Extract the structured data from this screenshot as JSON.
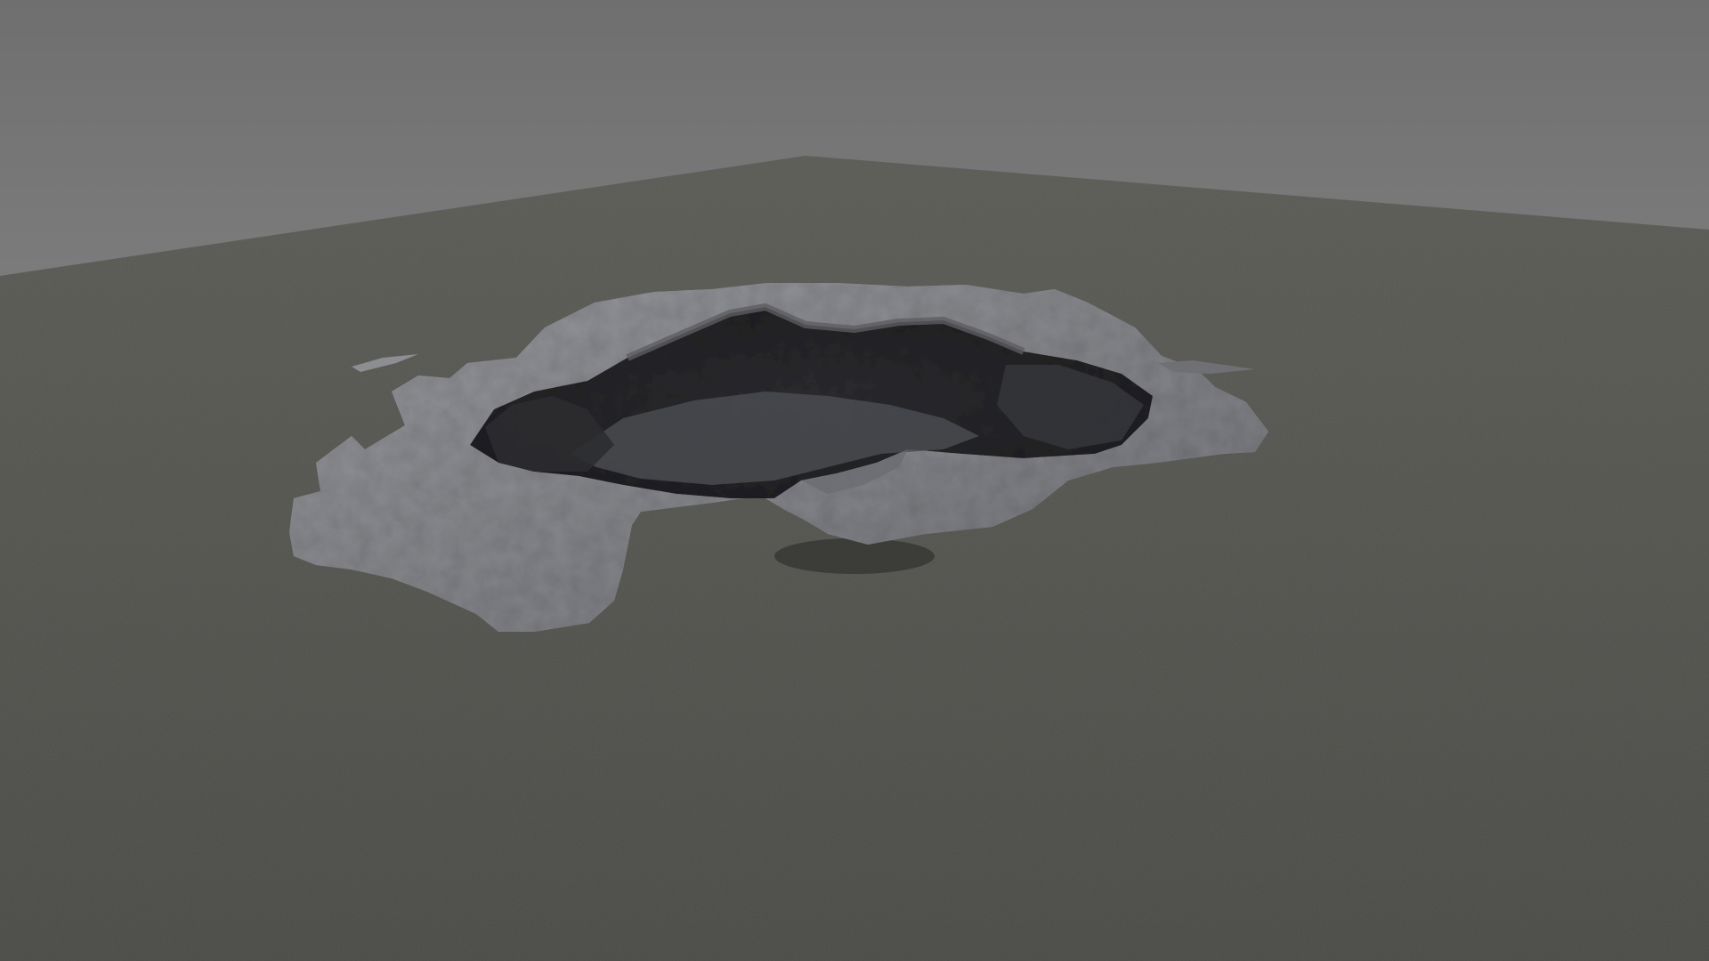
{
  "scene": {
    "colors": {
      "background_top": "#6f6f70",
      "background_bottom": "#9a9a9b",
      "ground": "#4a4a46",
      "ground_far": "#5a5a55",
      "rock_light": "#9a9ba0",
      "rock_mid": "#74757a",
      "crater_dark": "#2f2f33",
      "crater_shadow": "#1f1f22"
    }
  }
}
